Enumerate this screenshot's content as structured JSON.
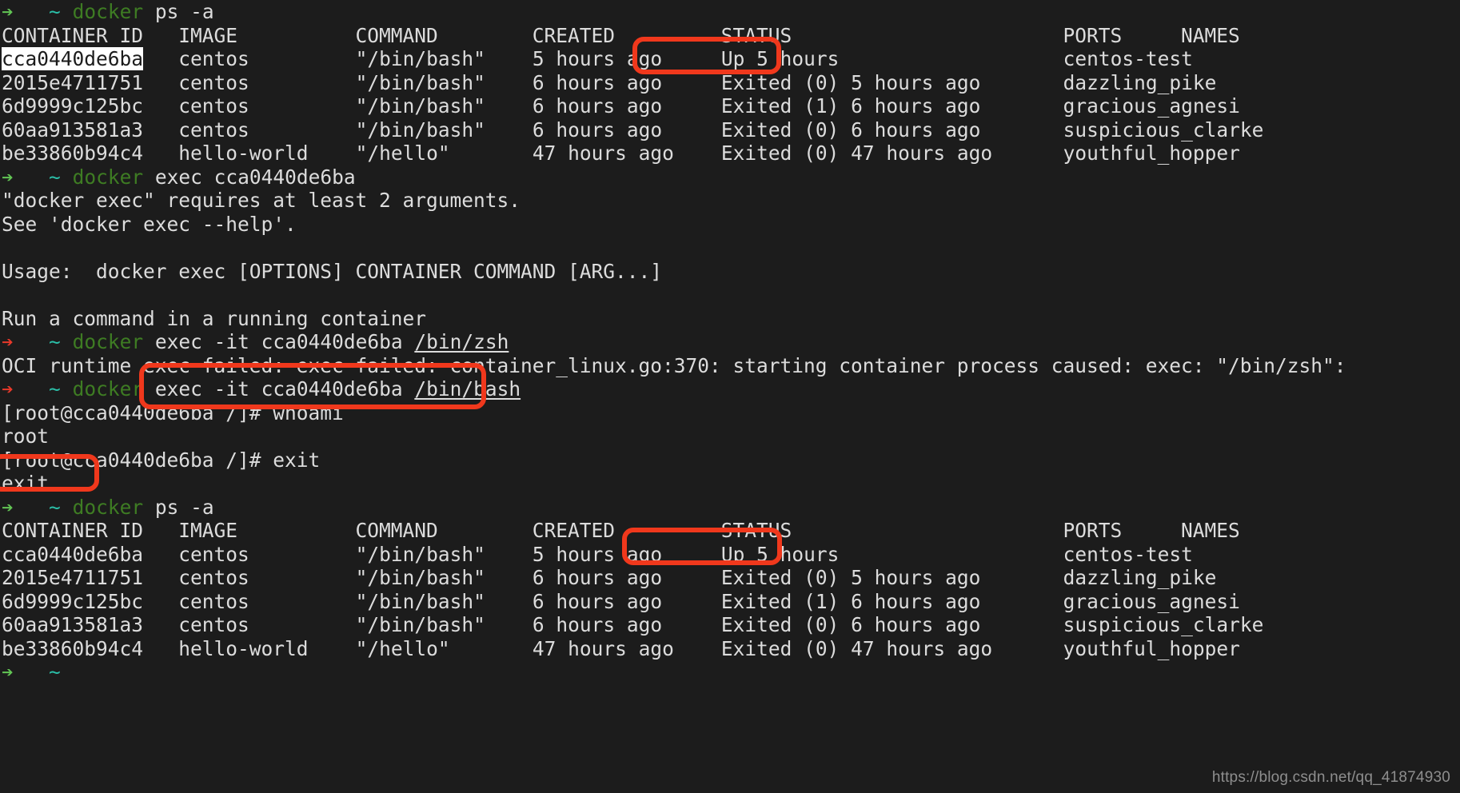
{
  "terminal": {
    "background_color": "#1c1c1c",
    "foreground_color": "#dcdcdc",
    "prompt_ok_color": "#62c554",
    "prompt_err_color": "#e8392a",
    "tilde_color": "#2bbfa8",
    "command_color": "#3e7c23",
    "annotation_color": "#f0381c",
    "selection_background": "#ffffff"
  },
  "prompt": {
    "arrow": "➔",
    "tilde": "~",
    "gap": "  ",
    "space": " "
  },
  "commands": {
    "docker": "docker",
    "ps_args": " ps -a",
    "exec_no_args": " exec cca0440de6ba",
    "exec_zsh_pre": " exec -it cca0440de6ba ",
    "exec_zsh_path": "/bin/zsh",
    "exec_bash_pre": " exec -it cca0440de6ba ",
    "exec_bash_path": "/bin/bash"
  },
  "table": {
    "headers": [
      "CONTAINER ID",
      "IMAGE",
      "COMMAND",
      "CREATED",
      "STATUS",
      "PORTS",
      "NAMES"
    ],
    "header_line": "CONTAINER ID   IMAGE          COMMAND        CREATED         STATUS                       PORTS     NAMES",
    "rows": [
      {
        "id": "cca0440de6ba",
        "image": "centos",
        "command": "\"/bin/bash\"",
        "created": "5 hours ago",
        "status": "Up 5 hours",
        "ports": "",
        "names": "centos-test"
      },
      {
        "id": "2015e4711751",
        "image": "centos",
        "command": "\"/bin/bash\"",
        "created": "6 hours ago",
        "status": "Exited (0) 5 hours ago",
        "ports": "",
        "names": "dazzling_pike"
      },
      {
        "id": "6d9999c125bc",
        "image": "centos",
        "command": "\"/bin/bash\"",
        "created": "6 hours ago",
        "status": "Exited (1) 6 hours ago",
        "ports": "",
        "names": "gracious_agnesi"
      },
      {
        "id": "60aa913581a3",
        "image": "centos",
        "command": "\"/bin/bash\"",
        "created": "6 hours ago",
        "status": "Exited (0) 6 hours ago",
        "ports": "",
        "names": "suspicious_clarke"
      },
      {
        "id": "be33860b94c4",
        "image": "hello-world",
        "command": "\"/hello\"",
        "created": "47 hours ago",
        "status": "Exited (0) 47 hours ago",
        "ports": "",
        "names": "youthful_hopper"
      }
    ]
  },
  "output": {
    "err_requires_args": "\"docker exec\" requires at least 2 arguments.",
    "err_see_help": "See 'docker exec --help'.",
    "blank": "",
    "usage": "Usage:  docker exec [OPTIONS] CONTAINER COMMAND [ARG...]",
    "description": "Run a command in a running container",
    "oci_error": "OCI runtime exec failed: exec failed: container_linux.go:370: starting container process caused: exec: \"/bin/zsh\":",
    "container_prompt_whoami": "[root@cca0440de6ba /]# whoami",
    "whoami_result": "root",
    "container_prompt_exit": "[root@cca0440de6ba /]# exit",
    "exit_echo": "exit"
  },
  "annotations": [
    {
      "label": "status-up-5-hours-top",
      "target": "Up 5 hours"
    },
    {
      "label": "exec-it-bin-bash",
      "target": "exec -it cca0440de6ba /bin/bash"
    },
    {
      "label": "exit-echo",
      "target": "exit"
    },
    {
      "label": "status-up-5-hours-bottom",
      "target": "Up 5 hours"
    }
  ],
  "watermark": {
    "text": "https://blog.csdn.net/qq_41874930"
  }
}
